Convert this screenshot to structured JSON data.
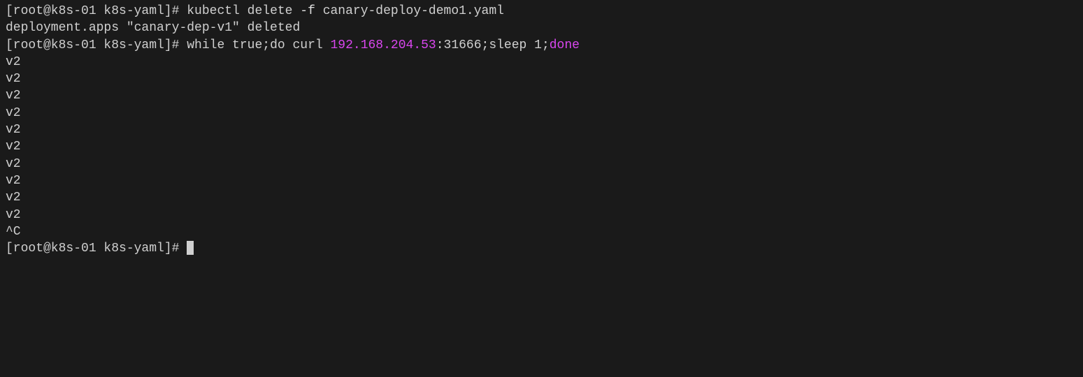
{
  "lines": {
    "line1": {
      "prompt": "[root@k8s-01 k8s-yaml]# ",
      "cmd_part1": "kubectl delete ",
      "flag": "-f",
      "cmd_part2": " canary-deploy-demo1.yaml"
    },
    "line2": "deployment.apps \"canary-dep-v1\" deleted",
    "line3": {
      "prompt": "[root@k8s-01 k8s-yaml]# ",
      "cmd_part1": "while true;do curl ",
      "ip": "192.168.204.53",
      "cmd_part2": ":31666;sleep 1;",
      "done": "done"
    },
    "output": [
      "v2",
      "v2",
      "v2",
      "v2",
      "v2",
      "v2",
      "v2",
      "v2",
      "v2",
      "v2"
    ],
    "interrupt": "^C",
    "final_prompt": "[root@k8s-01 k8s-yaml]# "
  }
}
